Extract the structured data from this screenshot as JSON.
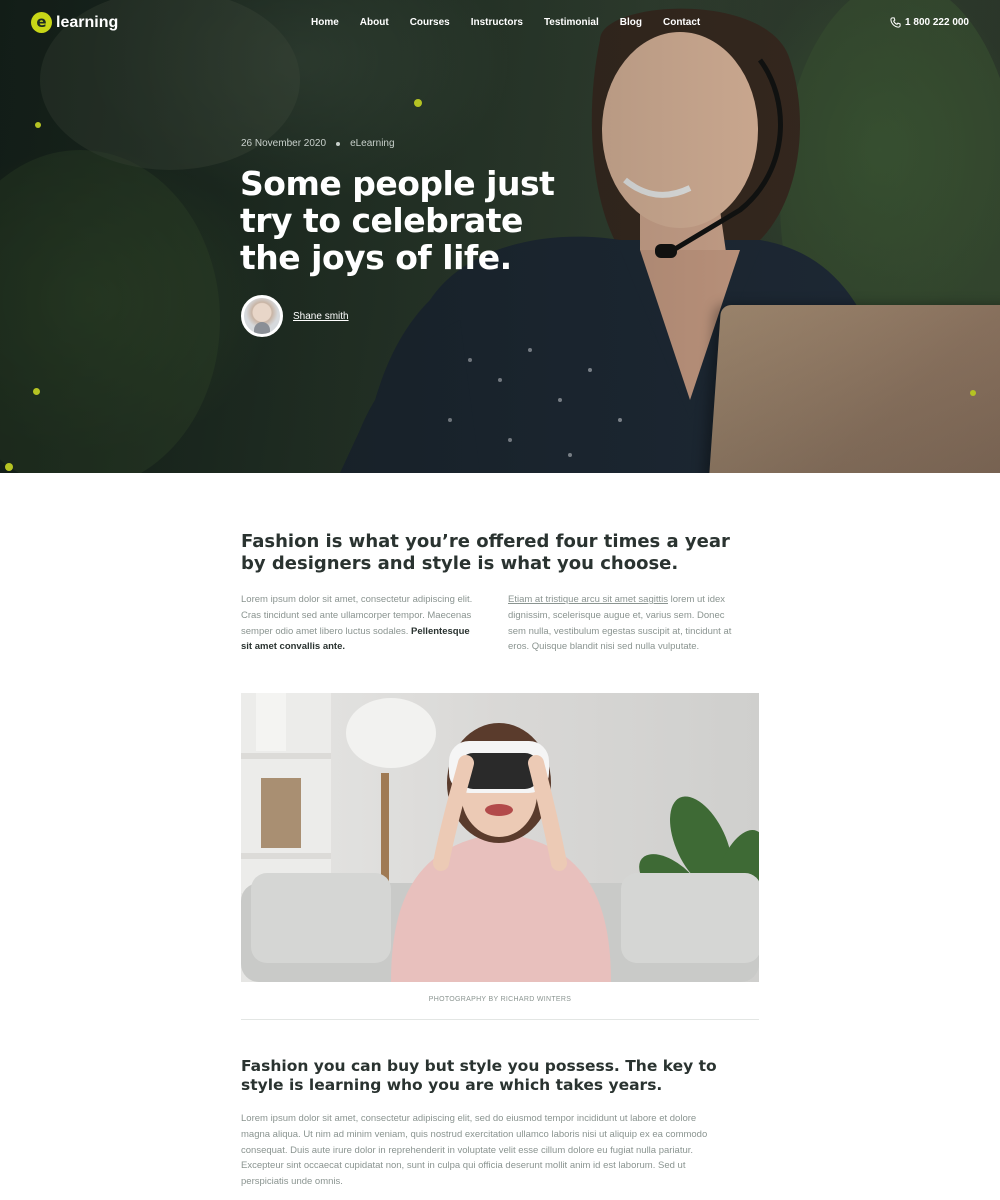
{
  "nav": {
    "logo_mark": "e",
    "logo_text": "learning",
    "items": [
      "Home",
      "About",
      "Courses",
      "Instructors",
      "Testimonial",
      "Blog",
      "Contact"
    ],
    "phone": "1 800 222 000"
  },
  "hero": {
    "date": "26 November 2020",
    "category": "eLearning",
    "title": "Some people just try to celebrate the joys of life.",
    "author": "Shane smith"
  },
  "article": {
    "lead": "Fashion is what you’re offered four times a year by designers and style is what you choose.",
    "col_left_text": "Lorem ipsum dolor sit amet, consectetur adipiscing elit. Cras tincidunt sed ante ullamcorper tempor. Maecenas semper odio amet libero luctus sodales.",
    "col_left_bold": "Pellentesque sit amet convallis ante.",
    "col_right_link": "Etiam at tristique arcu sit amet sagittis",
    "col_right_text": "lorem ut idex dignissim, scelerisque augue et, varius sem. Donec sem nulla, vestibulum egestas suscipit at, tincidunt at eros. Quisque blandit nisi sed nulla vulputate.",
    "photo_caption": "PHOTOGRAPHY BY RICHARD WINTERS",
    "heading2": "Fashion you can buy but style you possess. The key to style is learning who you are which takes years.",
    "body": "Lorem ipsum dolor sit amet, consectetur adipiscing elit, sed do eiusmod tempor incididunt ut labore et dolore magna aliqua. Ut nim ad minim veniam, quis nostrud exercitation ullamco laboris nisi ut aliquip ex ea commodo consequat. Duis aute irure dolor in reprehenderit in voluptate velit esse cillum dolore eu fugiat nulla pariatur. Excepteur sint occaecat cupidatat non, sunt in culpa qui officia deserunt mollit anim id est laborum. Sed ut perspiciatis unde omnis."
  },
  "colors": {
    "accent": "#c8d617",
    "hero_bg": "#2b3b2d",
    "text_dark": "#2a3330",
    "text_muted": "#8a9490"
  },
  "icons": {
    "phone": "phone-icon",
    "logo": "logo-icon"
  }
}
